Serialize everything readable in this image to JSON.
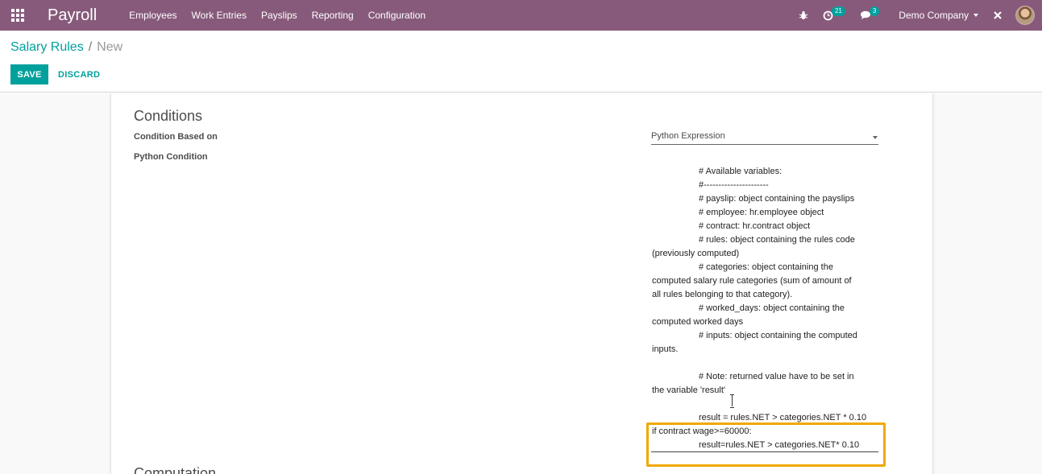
{
  "navbar": {
    "app_name": "Payroll",
    "menu": [
      "Employees",
      "Work Entries",
      "Payslips",
      "Reporting",
      "Configuration"
    ],
    "activity_count": "21",
    "message_count": "3",
    "company": "Demo Company",
    "icons": [
      "apps-icon",
      "bug-icon",
      "activity-clock-icon",
      "chat-icon",
      "close-icon",
      "avatar"
    ]
  },
  "breadcrumb": {
    "parent": "Salary Rules",
    "separator": "/",
    "current": "New"
  },
  "buttons": {
    "save": "SAVE",
    "discard": "DISCARD"
  },
  "form": {
    "section_title": "Conditions",
    "condition_based_on_label": "Condition Based on",
    "condition_based_on_value": "Python Expression",
    "python_condition_label": "Python Condition",
    "python_condition_lines": [
      {
        "text": "# Available variables:",
        "indent": true
      },
      {
        "text": "#----------------------",
        "indent": true
      },
      {
        "text": "# payslip: object containing the payslips",
        "indent": true
      },
      {
        "text": "# employee: hr.employee object",
        "indent": true
      },
      {
        "text": "# contract: hr.contract object",
        "indent": true
      },
      {
        "text": "# rules: object containing the rules code",
        "indent": true
      },
      {
        "text": "(previously computed)",
        "indent": false
      },
      {
        "text": "# categories: object containing the",
        "indent": true
      },
      {
        "text": "computed salary rule categories (sum of amount of",
        "indent": false
      },
      {
        "text": "all rules belonging to that category).",
        "indent": false
      },
      {
        "text": "# worked_days: object containing the",
        "indent": true
      },
      {
        "text": "computed worked days",
        "indent": false
      },
      {
        "text": "# inputs: object containing the computed",
        "indent": true
      },
      {
        "text": "inputs.",
        "indent": false
      },
      {
        "text": "",
        "indent": false
      },
      {
        "text": "# Note: returned value have to be set in",
        "indent": true
      },
      {
        "text": "the variable 'result'",
        "indent": false
      },
      {
        "text": "",
        "indent": false
      },
      {
        "text": "result = rules.NET > categories.NET * 0.10",
        "indent": true
      },
      {
        "text": "if contract wage>=60000:",
        "indent": false
      },
      {
        "text": "result=rules.NET > categories.NET* 0.10",
        "indent": true
      }
    ],
    "next_section_title": "Computation"
  },
  "colors": {
    "navbar": "#875a7b",
    "accent": "#00a09d",
    "highlight": "#f0a800"
  }
}
